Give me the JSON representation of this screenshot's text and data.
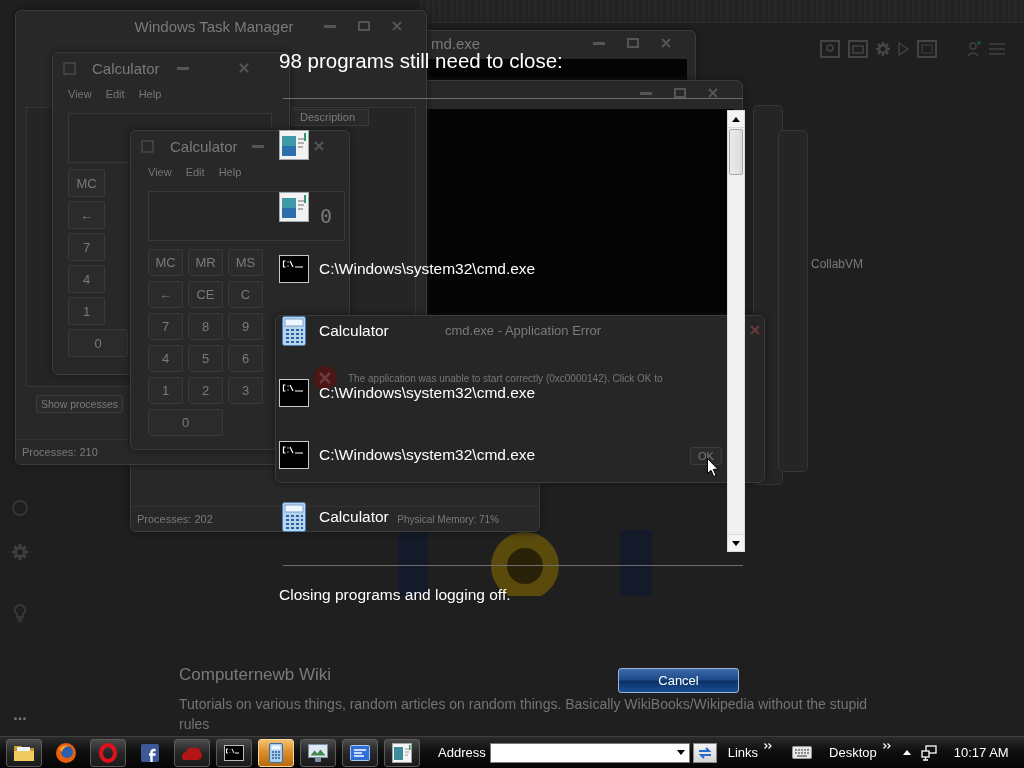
{
  "logoff": {
    "title": "98 programs still need to close:",
    "programs": [
      {
        "kind": "window"
      },
      {
        "kind": "window"
      },
      {
        "kind": "console",
        "name": "C:\\Windows\\system32\\cmd.exe"
      },
      {
        "kind": "calculator",
        "name": "Calculator"
      },
      {
        "kind": "console",
        "name": "C:\\Windows\\system32\\cmd.exe"
      },
      {
        "kind": "console",
        "name": "C:\\Windows\\system32\\cmd.exe"
      },
      {
        "kind": "calculator",
        "name": "Calculator"
      }
    ],
    "status": "Closing programs and logging off.",
    "cancel_button": "Cancel"
  },
  "background_windows": [
    {
      "kind": "task_manager",
      "title": "Windows Task Manager",
      "columns": [
        "Description"
      ],
      "button": "Show processes",
      "status": [
        "Processes: 210"
      ]
    },
    {
      "kind": "console",
      "title": "md.exe"
    },
    {
      "kind": "calculator",
      "title": "Calculator",
      "menu": [
        "View",
        "Edit",
        "Help"
      ],
      "key_rows": [
        [
          "MC"
        ],
        [
          "←"
        ],
        [
          "7"
        ],
        [
          "4"
        ],
        [
          "1"
        ],
        [
          "0"
        ]
      ]
    },
    {
      "kind": "console"
    },
    {
      "kind": "calculator",
      "title": "Calculator",
      "menu": [
        "View",
        "Edit",
        "Help"
      ],
      "display": "0",
      "key_rows": [
        [
          "MC",
          "MR",
          "MS"
        ],
        [
          "←",
          "CE",
          "C"
        ],
        [
          "7",
          "8",
          "9"
        ],
        [
          "4",
          "5",
          "6"
        ],
        [
          "1",
          "2",
          "3"
        ],
        [
          "0"
        ]
      ]
    },
    {
      "kind": "error_dialog",
      "title": "cmd.exe - Application Error",
      "message": "The application was unable to start correctly (0xc0000142). Click OK to",
      "button": "OK"
    },
    {
      "kind": "task_manager",
      "status": [
        "Processes: 202",
        "Physical Memory: 71%"
      ]
    }
  ],
  "browser_page": {
    "link": "CollabVM",
    "heading": "Computernewb Wiki",
    "description": "Tutorials on various things, random articles on random things. Basically WikiBooks/Wikipedia without the stupid rules",
    "more": "..."
  },
  "taskbar": {
    "buttons": [
      {
        "kind": "explorer",
        "open": true,
        "highlighted": false
      },
      {
        "kind": "firefox",
        "open": false,
        "highlighted": false
      },
      {
        "kind": "opera",
        "open": true,
        "highlighted": false
      },
      {
        "kind": "facebook",
        "open": false,
        "highlighted": false
      },
      {
        "kind": "red_app",
        "open": true,
        "highlighted": false
      },
      {
        "kind": "console",
        "open": true,
        "highlighted": false
      },
      {
        "kind": "calculator",
        "open": true,
        "highlighted": true
      },
      {
        "kind": "pictures",
        "open": true,
        "highlighted": false
      },
      {
        "kind": "blue_app",
        "open": true,
        "highlighted": false
      },
      {
        "kind": "window",
        "open": true,
        "highlighted": false
      }
    ],
    "address_label": "Address",
    "links_label": "Links",
    "desktop_label": "Desktop",
    "clock": "10:17 AM"
  }
}
